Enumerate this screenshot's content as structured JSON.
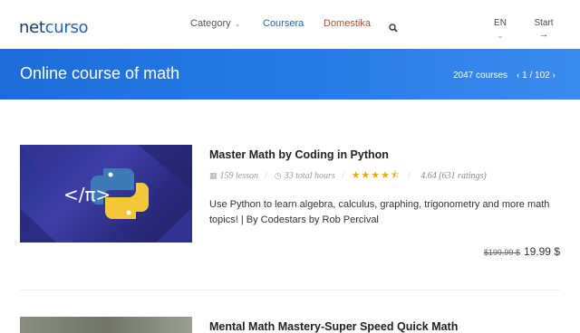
{
  "header": {
    "logo_part1": "net",
    "logo_part2": "curso",
    "nav": {
      "category": "Category",
      "coursera": "Coursera",
      "domestika": "Domestika"
    },
    "lang": "EN",
    "start": "Start"
  },
  "banner": {
    "title": "Online course of math",
    "count": "2047 courses",
    "pager_prev": "‹",
    "pager_text": "1 / 102",
    "pager_next": "›"
  },
  "courses": [
    {
      "title": "Master Math by Coding in Python",
      "lessons": "159 lesson",
      "hours": "33 total hours",
      "rating_value": 4.64,
      "rating_text": "4.64 (631 ratings)",
      "description": "Use Python to learn algebra, calculus, graphing, trigonometry and more math topics! | By Codestars by Rob Percival",
      "old_price": "$199.99 $",
      "price": "19.99 $",
      "thumb_text": "</π>"
    },
    {
      "title": "Mental Math Mastery-Super Speed Quick Math"
    }
  ],
  "colors": {
    "brand_blue": "#1f63b8",
    "domestika": "#b5522b",
    "banner": "#2a7de6",
    "stars": "#f0a911"
  }
}
